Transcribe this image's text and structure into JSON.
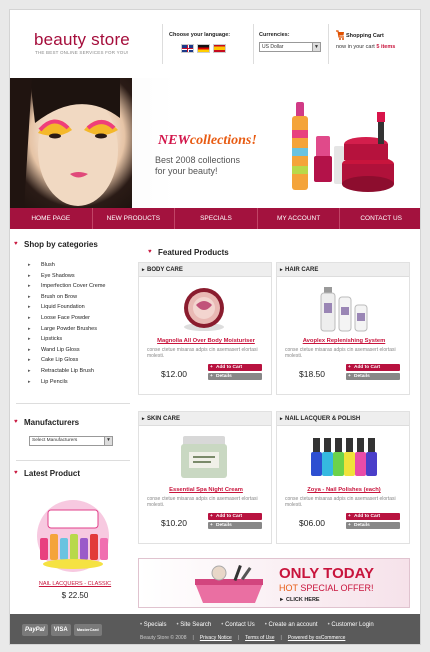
{
  "header": {
    "logo": "beauty store",
    "tagline": "THE BEST ONLINE SERVICES FOR YOU!",
    "language_label": "Choose your language:",
    "languages": [
      "English",
      "Deutsch",
      "Español"
    ],
    "currency_label": "Currencies:",
    "currency_value": "US Dollar",
    "cart_label": "Shopping Cart",
    "cart_now_prefix": "now in your cart",
    "cart_count": "5 items"
  },
  "banner": {
    "new_word": "NEW",
    "collections_word": "collections!",
    "line1": "Best 2008 collections",
    "line2": "for your beauty!"
  },
  "nav": [
    "HOME PAGE",
    "NEW PRODUCTS",
    "SPECIALS",
    "MY ACCOUNT",
    "CONTACT US"
  ],
  "sidebar": {
    "categories_title": "Shop by categories",
    "categories": [
      "Blush",
      "Eye Shadows",
      "Imperfection Cover Creme",
      "Brush on Brow",
      "Liquid Foundation",
      "Loose Face Powder",
      "Large Powder Brushes",
      "Lipsticks",
      "Wand Lip Gloss",
      "Cake Lip Gloss",
      "Retractable Lip Brush",
      "Lip Pencils"
    ],
    "manufacturers_title": "Manufacturers",
    "manufacturers_select": "Select Manufacturers",
    "latest_title": "Latest Product",
    "latest_name": "NAIL LACQUERS - CLASSIC",
    "latest_price": "$ 22.50"
  },
  "main": {
    "title": "Featured Products",
    "add_to_cart": "Add to Cart",
    "details": "Details",
    "products": [
      {
        "category": "BODY CARE",
        "name": "Magnolia All Over Body Moisturiser",
        "desc": "conse ctetue misaras adpis cin asemasert elortasi molesti.",
        "price": "$12.00"
      },
      {
        "category": "HAIR CARE",
        "name": "Avoplex Replenishing System",
        "desc": "conse ctetue misaras adpis cin asemasert elortasi molesti.",
        "price": "$18.50"
      },
      {
        "category": "SKIN CARE",
        "name": "Essential Spa Night Cream",
        "desc": "conse ctetue misaras adpis cin asemasert elortasi molesti.",
        "price": "$10.20"
      },
      {
        "category": "NAIL LACQUER & POLISH",
        "name": "Zoya - Nail Polishes (each)",
        "desc": "conse ctetue misaras adpis cin asemasert elortasi molesti.",
        "price": "$06.00"
      }
    ],
    "promo": {
      "only": "ONLY TODAY",
      "hot": "HOT",
      "special": "SPECIAL OFFER!",
      "click": "CLICK HERE"
    }
  },
  "footer": {
    "cards": [
      "PayPal",
      "VISA",
      "MasterCard"
    ],
    "links": [
      "Specials",
      "Site Search",
      "Contact Us",
      "Create an account",
      "Customer Login"
    ],
    "copyright": "Beauty Store © 2008",
    "privacy": "Privacy Notice",
    "terms": "Terms of Use",
    "powered": "Powered by osCommerce"
  },
  "colors": {
    "brand": "#a3123e",
    "accent": "#c8143c",
    "orange": "#e85b12"
  }
}
